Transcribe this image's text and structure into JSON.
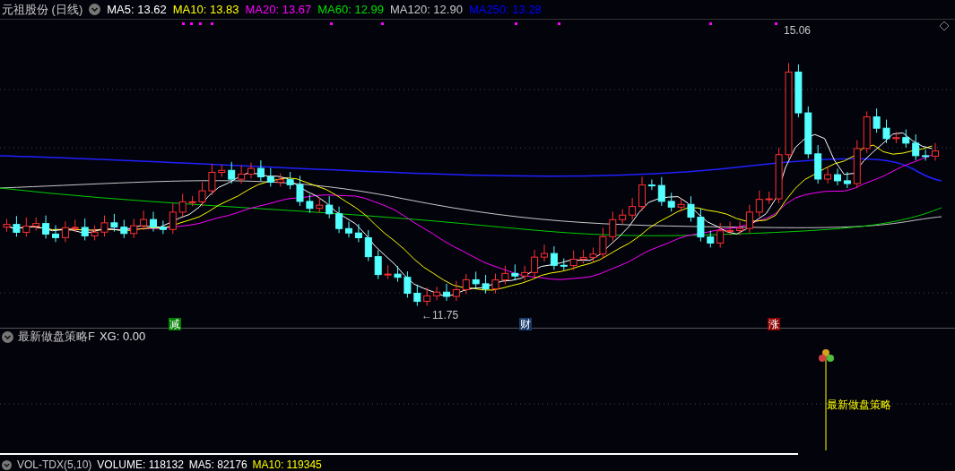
{
  "header": {
    "title": "元祖股份 (日线)",
    "indicators": [
      {
        "label": "MA5: 13.62",
        "color": "#ffffff"
      },
      {
        "label": "MA10: 13.83",
        "color": "#ffff00"
      },
      {
        "label": "MA20: 13.67",
        "color": "#ff00ff"
      },
      {
        "label": "MA60: 12.99",
        "color": "#00e000"
      },
      {
        "label": "MA120: 12.90",
        "color": "#c8c8c8"
      },
      {
        "label": "MA250: 13.28",
        "color": "#0000ff"
      }
    ]
  },
  "price_panel": {
    "high_label": "15.06",
    "low_label": "←11.75",
    "signals": [
      {
        "text": "减",
        "color": "#008000"
      },
      {
        "text": "财",
        "color": "#1a3a6a"
      },
      {
        "text": "涨",
        "color": "#8b0000"
      }
    ]
  },
  "indicator_panel": {
    "title": "最新做盘策略F",
    "reading": "XG: 0.00",
    "signal_label": "最新做盘策略"
  },
  "volume_panel": {
    "items": [
      {
        "label": "VOL-TDX(5,10)",
        "color": "#c8c8c8"
      },
      {
        "label": "VOLUME: 118132",
        "color": "#ffffff"
      },
      {
        "label": "MA5: 82176",
        "color": "#ffffff"
      },
      {
        "label": "MA10: 119345",
        "color": "#ffff00"
      }
    ]
  }
}
